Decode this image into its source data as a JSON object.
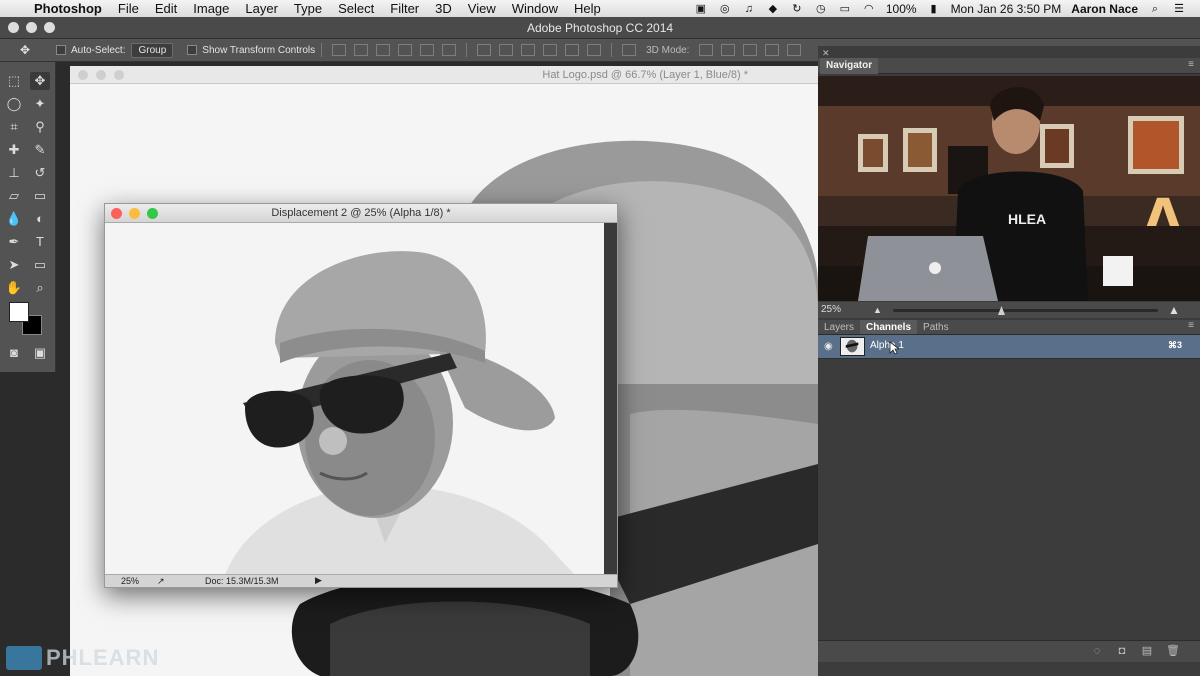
{
  "menubar": {
    "app_name": "Photoshop",
    "items": [
      "File",
      "Edit",
      "Image",
      "Layer",
      "Type",
      "Select",
      "Filter",
      "3D",
      "View",
      "Window",
      "Help"
    ],
    "battery": "100%",
    "datetime": "Mon Jan 26  3:50 PM",
    "user": "Aaron Nace"
  },
  "app": {
    "title": "Adobe Photoshop CC 2014"
  },
  "options": {
    "auto_select_label": "Auto-Select:",
    "auto_select_value": "Group",
    "transform_label": "Show Transform Controls",
    "mode3d_label": "3D Mode:"
  },
  "document": {
    "tab_title": "Hat Logo.psd @ 66.7% (Layer 1, Blue/8) *"
  },
  "float_window": {
    "title": "Displacement 2 @ 25% (Alpha 1/8) *",
    "zoom": "25%",
    "doc_size": "Doc: 15.3M/15.3M"
  },
  "watermark": {
    "text": "PHLEARN"
  },
  "navigator": {
    "tab": "Navigator",
    "zoom": "25%"
  },
  "panels": {
    "tabs": [
      "Layers",
      "Channels",
      "Paths"
    ],
    "active_tab": "Channels",
    "channel": {
      "name": "Alpha 1",
      "shortcut": "⌘3"
    }
  },
  "colors": {
    "selection": "#596f8a",
    "panel": "#3c3c3c",
    "toolbar": "#535353"
  }
}
